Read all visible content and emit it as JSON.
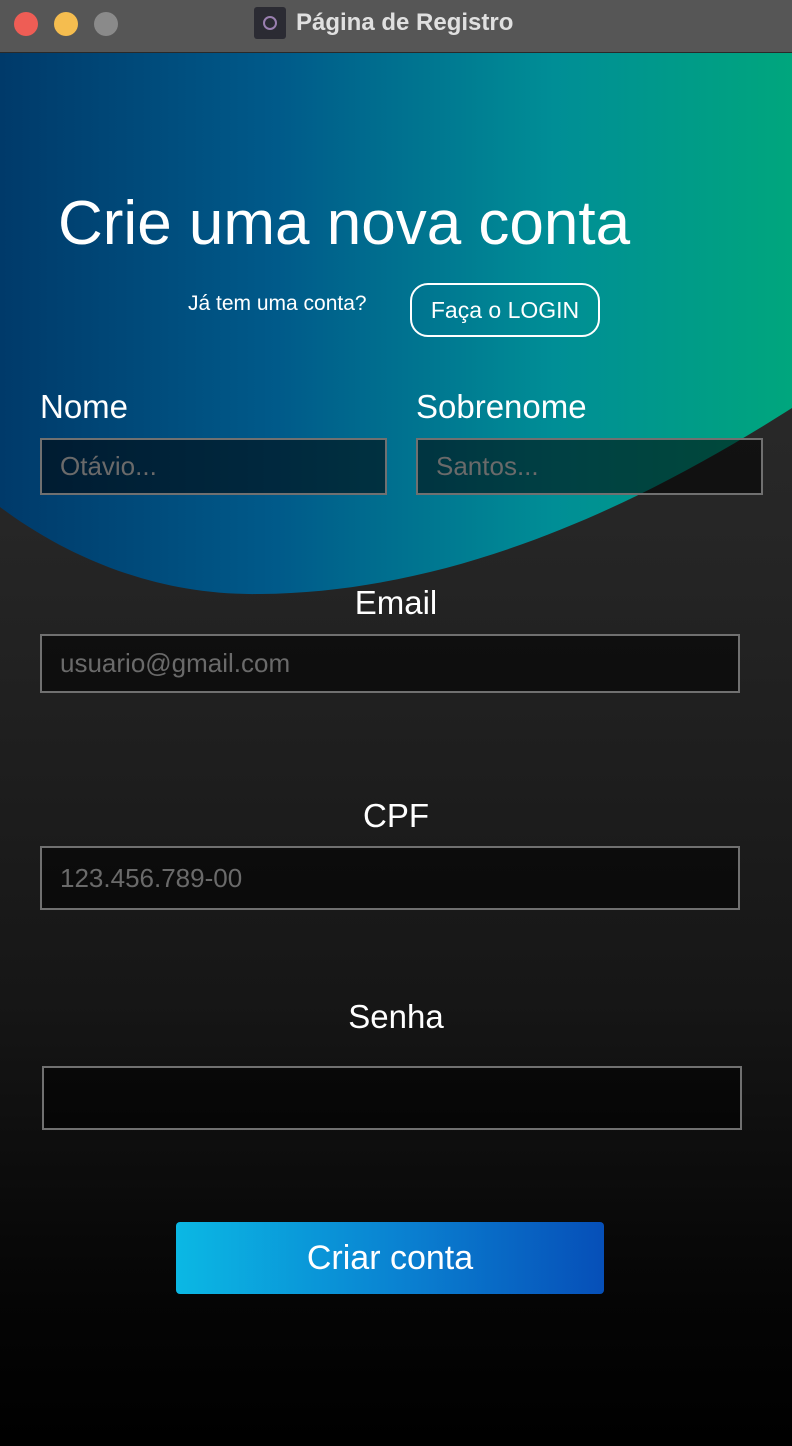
{
  "window": {
    "title": "Página de Registro"
  },
  "header": {
    "heading": "Crie uma nova conta",
    "have_account": "Já tem uma conta?",
    "login_button": "Faça o LOGIN"
  },
  "form": {
    "first_name": {
      "label": "Nome",
      "placeholder": "Otávio..."
    },
    "last_name": {
      "label": "Sobrenome",
      "placeholder": "Santos..."
    },
    "email": {
      "label": "Email",
      "placeholder": "usuario@gmail.com"
    },
    "cpf": {
      "label": "CPF",
      "placeholder": "123.456.789-00"
    },
    "password": {
      "label": "Senha",
      "placeholder": ""
    },
    "submit": "Criar conta"
  },
  "colors": {
    "gradient_left": "#003a6a",
    "gradient_right": "#00a67d",
    "button_left": "#0bb8e4",
    "button_right": "#064fb8",
    "background": "#1e1e1e"
  }
}
